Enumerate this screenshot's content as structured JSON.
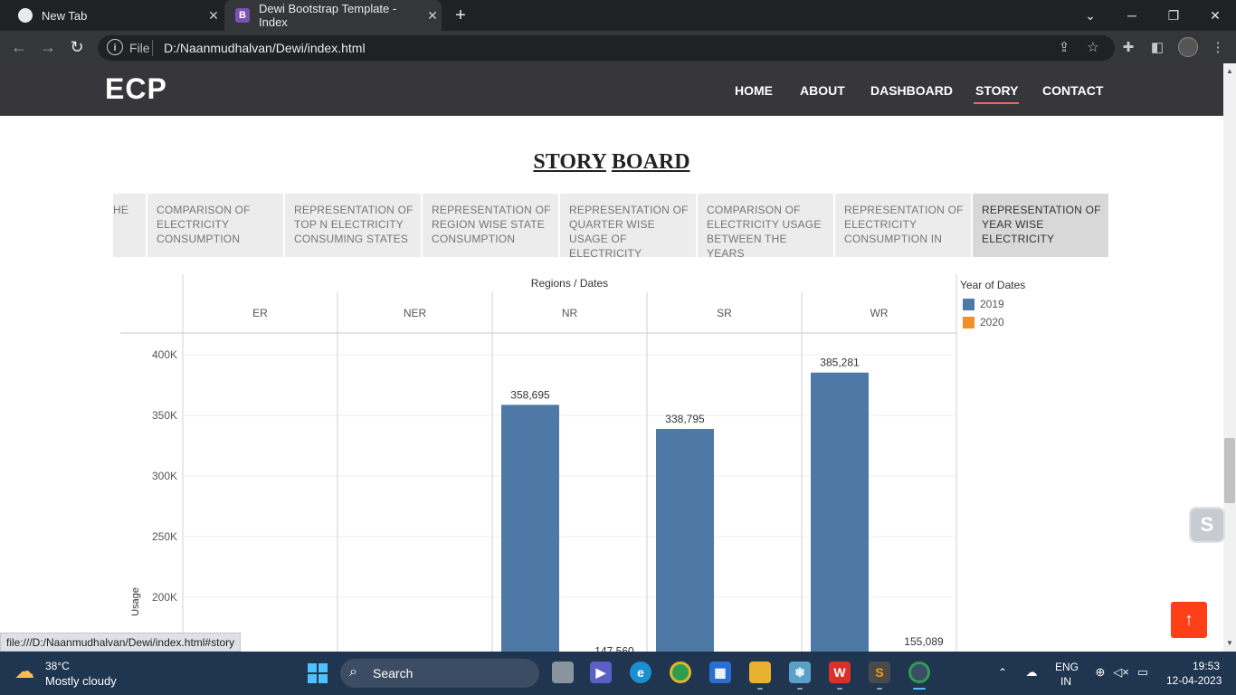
{
  "browser": {
    "tabs": [
      {
        "title": "New Tab",
        "active": false
      },
      {
        "title": "Dewi Bootstrap Template - Index",
        "active": true
      }
    ],
    "new_tab": "+",
    "address": {
      "scheme_label": "File",
      "url": "D:/Naanmudhalvan/Dewi/index.html"
    },
    "status_url": "file:///D:/Naanmudhalvan/Dewi/index.html#story"
  },
  "site": {
    "logo": "ECP",
    "nav": [
      "HOME",
      "ABOUT",
      "DASHBOARD",
      "STORY",
      "CONTACT"
    ],
    "active_nav": "STORY",
    "accent_color": "#e96b56",
    "header_bg": "#37373b"
  },
  "story": {
    "title_word1": "STORY",
    "title_word2": "BOARD",
    "tabs": [
      "HE",
      "COMPARISON OF ELECTRICITY CONSUMPTION",
      "REPRESENTATION OF TOP N ELECTRICITY CONSUMING STATES",
      "REPRESENTATION OF REGION WISE STATE CONSUMPTION",
      "REPRESENTATION OF QUARTER WISE USAGE OF ELECTRICITY",
      "COMPARISON OF ELECTRICITY USAGE BETWEEN THE YEARS",
      "REPRESENTATION OF ELECTRICITY CONSUMPTION IN",
      "REPRESENTATION OF YEAR WISE ELECTRICITY"
    ],
    "active_tab_index": 7
  },
  "chart_data": {
    "type": "bar",
    "column_header": "Regions / Dates",
    "ylabel": "Usage",
    "regions": [
      "ER",
      "NER",
      "NR",
      "SR",
      "WR"
    ],
    "yticks": [
      "400K",
      "350K",
      "300K",
      "250K",
      "200K"
    ],
    "ylim": [
      0,
      410000
    ],
    "legend_title": "Year of Dates",
    "series": [
      {
        "name": "2019",
        "color": "#4e79a7",
        "values": [
          null,
          null,
          358695,
          338795,
          385281
        ],
        "labels": [
          "",
          "",
          "358,695",
          "338,795",
          "385,281"
        ]
      },
      {
        "name": "2020",
        "color": "#f28e2b",
        "values": [
          null,
          null,
          147560,
          null,
          155089
        ],
        "labels": [
          "",
          "",
          "147,560",
          "",
          "155,089"
        ]
      }
    ]
  },
  "taskbar": {
    "weather_temp": "38°C",
    "weather_desc": "Mostly cloudy",
    "search_label": "Search",
    "lang_line1": "ENG",
    "lang_line2": "IN",
    "time": "19:53",
    "date": "12-04-2023"
  },
  "icons": {
    "back_to_top": "↑"
  }
}
